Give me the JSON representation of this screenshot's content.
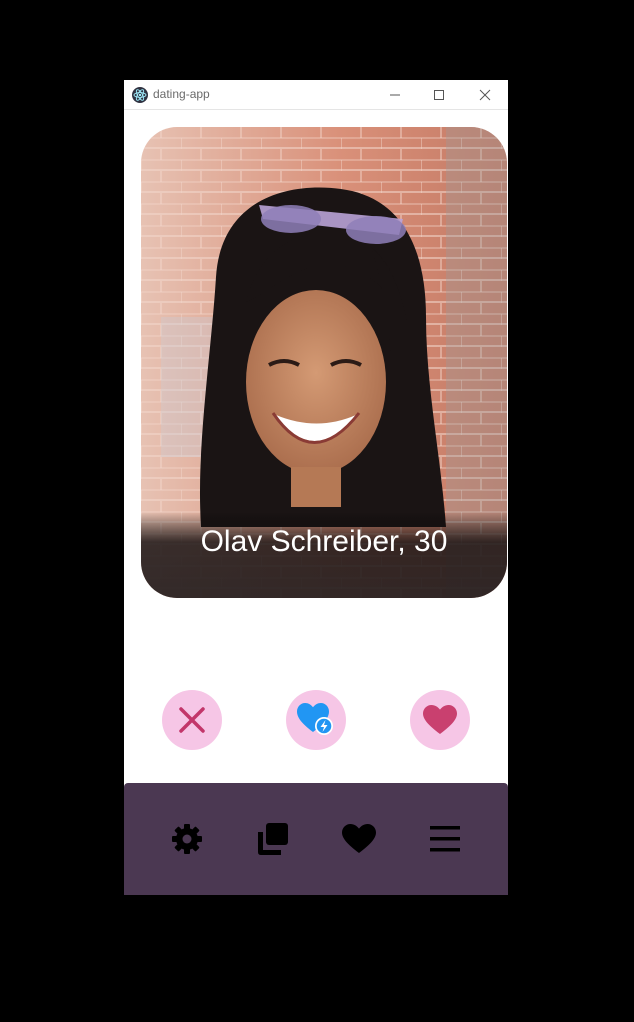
{
  "window": {
    "title": "dating-app",
    "controls": [
      "minimize",
      "maximize",
      "close"
    ]
  },
  "profile": {
    "name_age": "Olav Schreiber, 30"
  },
  "actions": {
    "nope_icon": "close-x-icon",
    "super_like_icon": "heart-bolt-icon",
    "like_icon": "heart-icon"
  },
  "nav": {
    "items": [
      "settings-gear-icon",
      "cards-stack-icon",
      "heart-icon",
      "hamburger-menu-icon"
    ]
  },
  "colors": {
    "nav_background": "#4b3852",
    "action_button_background": "#f6c6e6",
    "nope": "#c2366a",
    "super_like": "#2196f3",
    "like": "#c9406f",
    "nav_icons": "#000000"
  }
}
